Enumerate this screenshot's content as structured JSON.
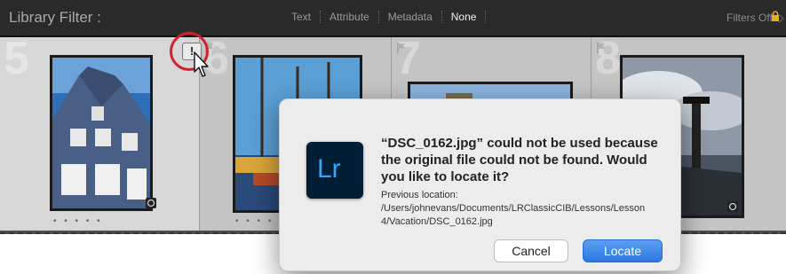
{
  "filter_bar": {
    "title": "Library Filter :",
    "options": [
      "Text",
      "Attribute",
      "Metadata",
      "None"
    ],
    "active_option": "None",
    "filters_off": "Filters Off ◇"
  },
  "grid": {
    "cells": [
      {
        "number": "5"
      },
      {
        "number": "6"
      },
      {
        "number": "7"
      },
      {
        "number": "8"
      }
    ],
    "rating_dots": "• • • • •",
    "missing_badge": "!"
  },
  "dialog": {
    "app_icon_text": "Lr",
    "title": "“DSC_0162.jpg” could not be used because the original file could not be found. Would you like to locate it?",
    "body": "Previous location: /Users/johnevans/Documents/LRClassicCIB/Lessons/Lesson 4/Vacation/DSC_0162.jpg",
    "cancel_label": "Cancel",
    "locate_label": "Locate"
  },
  "colors": {
    "accent_ring": "#d2202e",
    "locate_button": "#2a77e0",
    "app_icon_bg": "#001e36",
    "app_icon_fg": "#31a8ff"
  }
}
